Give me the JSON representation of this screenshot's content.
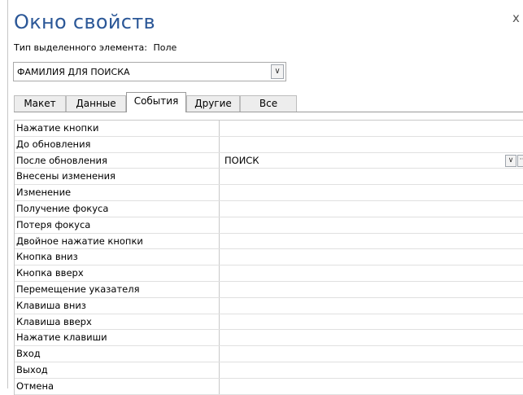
{
  "window": {
    "title": "Окно свойств",
    "close_symbol": "x"
  },
  "selection": {
    "type_label": "Тип выделенного элемента:",
    "type_value": "Поле",
    "combo_value": "ФАМИЛИЯ ДЛЯ ПОИСКА",
    "combo_arrow": "∨"
  },
  "tabs": [
    {
      "label": "Макет",
      "active": false
    },
    {
      "label": "Данные",
      "active": false
    },
    {
      "label": "События",
      "active": true
    },
    {
      "label": "Другие",
      "active": false
    },
    {
      "label": "Все",
      "active": false
    }
  ],
  "properties": [
    {
      "name": "Нажатие кнопки",
      "value": ""
    },
    {
      "name": "До обновления",
      "value": ""
    },
    {
      "name": "После обновления",
      "value": "ПОИСК",
      "dropdown": "∨",
      "builder": "···"
    },
    {
      "name": "Внесены изменения",
      "value": ""
    },
    {
      "name": "Изменение",
      "value": ""
    },
    {
      "name": "Получение фокуса",
      "value": ""
    },
    {
      "name": "Потеря фокуса",
      "value": ""
    },
    {
      "name": "Двойное нажатие кнопки",
      "value": ""
    },
    {
      "name": "Кнопка вниз",
      "value": ""
    },
    {
      "name": "Кнопка вверх",
      "value": ""
    },
    {
      "name": "Перемещение указателя",
      "value": ""
    },
    {
      "name": "Клавиша вниз",
      "value": ""
    },
    {
      "name": "Клавиша вверх",
      "value": ""
    },
    {
      "name": "Нажатие клавиши",
      "value": ""
    },
    {
      "name": "Вход",
      "value": ""
    },
    {
      "name": "Выход",
      "value": ""
    },
    {
      "name": "Отмена",
      "value": ""
    }
  ]
}
